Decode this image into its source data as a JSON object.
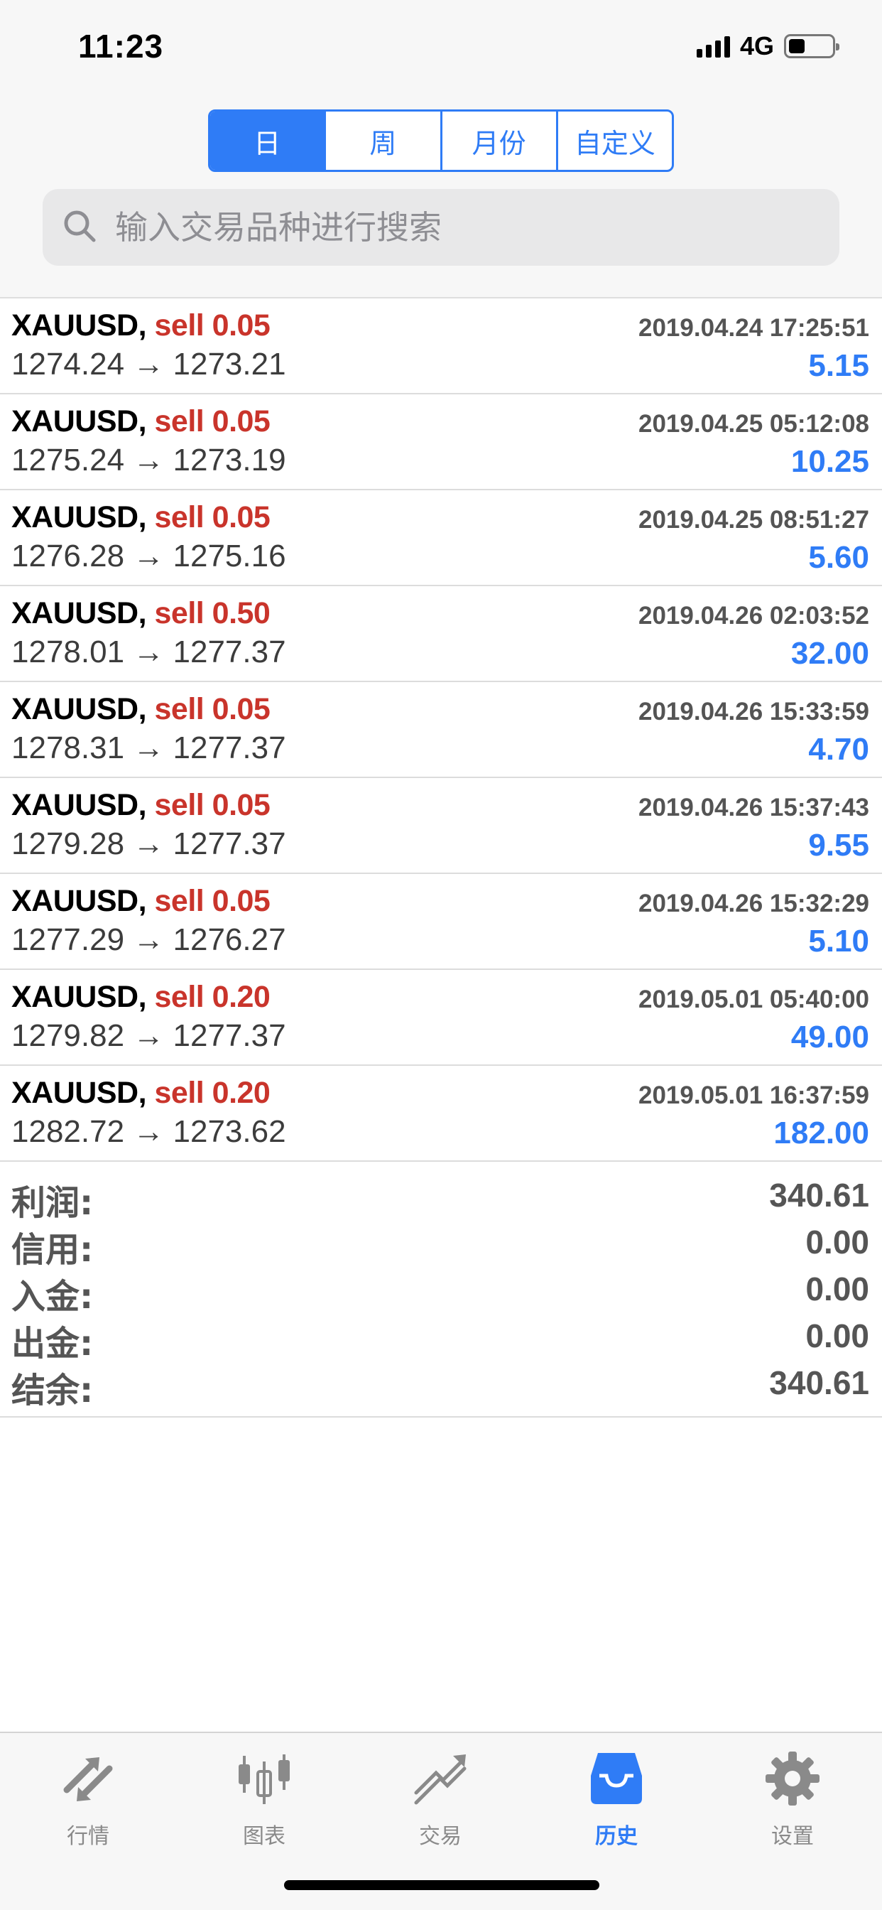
{
  "status_bar": {
    "time": "11:23",
    "network": "4G"
  },
  "period_tabs": [
    {
      "label": "日",
      "active": true
    },
    {
      "label": "周",
      "active": false
    },
    {
      "label": "月份",
      "active": false
    },
    {
      "label": "自定义",
      "active": false
    }
  ],
  "search": {
    "placeholder": "输入交易品种进行搜索"
  },
  "trades": [
    {
      "symbol": "XAUUSD,",
      "side": "sell 0.05",
      "datetime": "2019.04.24 17:25:51",
      "prices": "1274.24 → 1273.21",
      "profit": "5.15"
    },
    {
      "symbol": "XAUUSD,",
      "side": "sell 0.05",
      "datetime": "2019.04.25 05:12:08",
      "prices": "1275.24 → 1273.19",
      "profit": "10.25"
    },
    {
      "symbol": "XAUUSD,",
      "side": "sell 0.05",
      "datetime": "2019.04.25 08:51:27",
      "prices": "1276.28 → 1275.16",
      "profit": "5.60"
    },
    {
      "symbol": "XAUUSD,",
      "side": "sell 0.50",
      "datetime": "2019.04.26 02:03:52",
      "prices": "1278.01 → 1277.37",
      "profit": "32.00"
    },
    {
      "symbol": "XAUUSD,",
      "side": "sell 0.05",
      "datetime": "2019.04.26 15:33:59",
      "prices": "1278.31 → 1277.37",
      "profit": "4.70"
    },
    {
      "symbol": "XAUUSD,",
      "side": "sell 0.05",
      "datetime": "2019.04.26 15:37:43",
      "prices": "1279.28 → 1277.37",
      "profit": "9.55"
    },
    {
      "symbol": "XAUUSD,",
      "side": "sell 0.05",
      "datetime": "2019.04.26 15:32:29",
      "prices": "1277.29 → 1276.27",
      "profit": "5.10"
    },
    {
      "symbol": "XAUUSD,",
      "side": "sell 0.20",
      "datetime": "2019.05.01 05:40:00",
      "prices": "1279.82 → 1277.37",
      "profit": "49.00"
    },
    {
      "symbol": "XAUUSD,",
      "side": "sell 0.20",
      "datetime": "2019.05.01 16:37:59",
      "prices": "1282.72 → 1273.62",
      "profit": "182.00"
    }
  ],
  "summary": [
    {
      "label": "利润:",
      "value": "340.61"
    },
    {
      "label": "信用:",
      "value": "0.00"
    },
    {
      "label": "入金:",
      "value": "0.00"
    },
    {
      "label": "出金:",
      "value": "0.00"
    },
    {
      "label": "结余:",
      "value": "340.61"
    }
  ],
  "tab_bar": [
    {
      "label": "行情",
      "icon": "quotes-arrows-icon",
      "active": false
    },
    {
      "label": "图表",
      "icon": "candlestick-chart-icon",
      "active": false
    },
    {
      "label": "交易",
      "icon": "trade-chart-icon",
      "active": false
    },
    {
      "label": "历史",
      "icon": "history-inbox-icon",
      "active": true
    },
    {
      "label": "设置",
      "icon": "gear-icon",
      "active": false
    }
  ],
  "colors": {
    "accent": "#2f7cf6",
    "sell": "#c9342b",
    "text_gray": "#555555"
  }
}
